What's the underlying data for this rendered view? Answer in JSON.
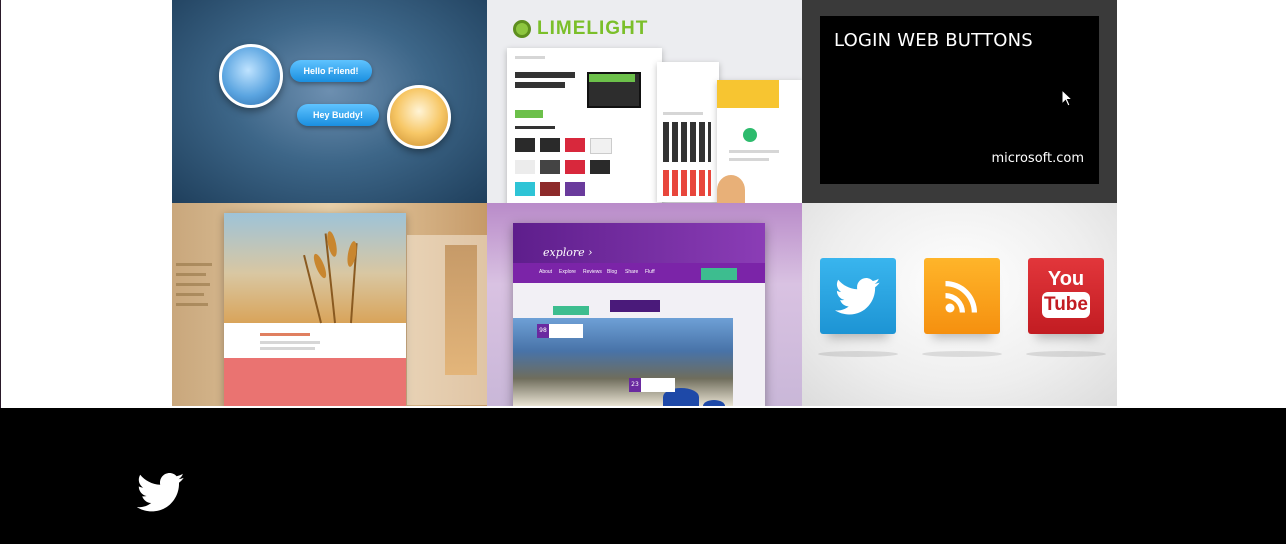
{
  "tiles": {
    "chat": {
      "bubble1": "Hello Friend!",
      "bubble2": "Hey Buddy!"
    },
    "limelight": {
      "logo_text": "LIMELIGHT"
    },
    "login": {
      "title": "LOGIN WEB BUTTONS",
      "source": "microsoft.com"
    },
    "explore": {
      "logo": "explore ›",
      "nav": [
        "About",
        "Explore",
        "Reviews",
        "Blog",
        "Share",
        "Fluff"
      ],
      "tag1_num": "98",
      "tag2_num": "23"
    },
    "social": {
      "youtube_top": "You",
      "youtube_bottom": "Tube"
    }
  },
  "footer": {
    "icons": [
      "twitter-icon"
    ]
  },
  "colors": {
    "footer_bg": "#000000",
    "login_card_bg": "#000000",
    "twitter_blue": "#1d94d4",
    "rss_orange": "#f5900f",
    "youtube_red": "#c21c22"
  }
}
